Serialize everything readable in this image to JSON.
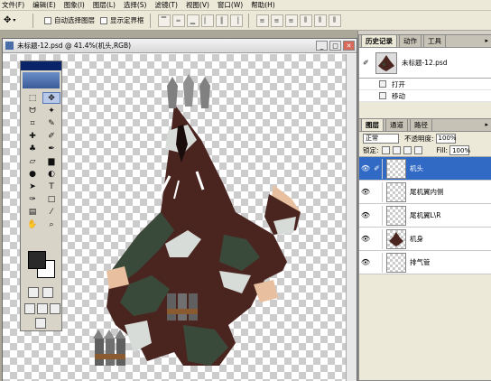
{
  "menu": [
    "文件(F)",
    "编辑(E)",
    "图象(I)",
    "图层(L)",
    "选择(S)",
    "滤镜(T)",
    "视图(V)",
    "窗口(W)",
    "帮助(H)"
  ],
  "options": {
    "auto_select_layer": "自动选择图层",
    "show_bounding_box": "显示定界框"
  },
  "document": {
    "title": "未标题-12.psd @ 41.4%(机头,RGB)"
  },
  "history": {
    "tabs": [
      "历史记录",
      "动作",
      "工具"
    ],
    "snapshot": "未标题-12.psd",
    "steps": [
      "打开",
      "移动"
    ]
  },
  "layers": {
    "tabs": [
      "图层",
      "通道",
      "路径"
    ],
    "blend_mode": "正常",
    "opacity_label": "不透明度:",
    "opacity": "100%",
    "lock_label": "锁定:",
    "fill_label": "Fill:",
    "fill": "100%",
    "items": [
      {
        "name": "机头",
        "active": true
      },
      {
        "name": "尾机翼内侧",
        "active": false
      },
      {
        "name": "尾机翼L\\R",
        "active": false
      },
      {
        "name": "机身",
        "active": false
      },
      {
        "name": "排气管",
        "active": false
      }
    ]
  },
  "colors": {
    "camo_brown": "#4a2520",
    "camo_green": "#3a4a3a",
    "camo_light": "#d8dcd8",
    "camo_peach": "#e8c0a0",
    "selection_blue": "#316ac5"
  }
}
